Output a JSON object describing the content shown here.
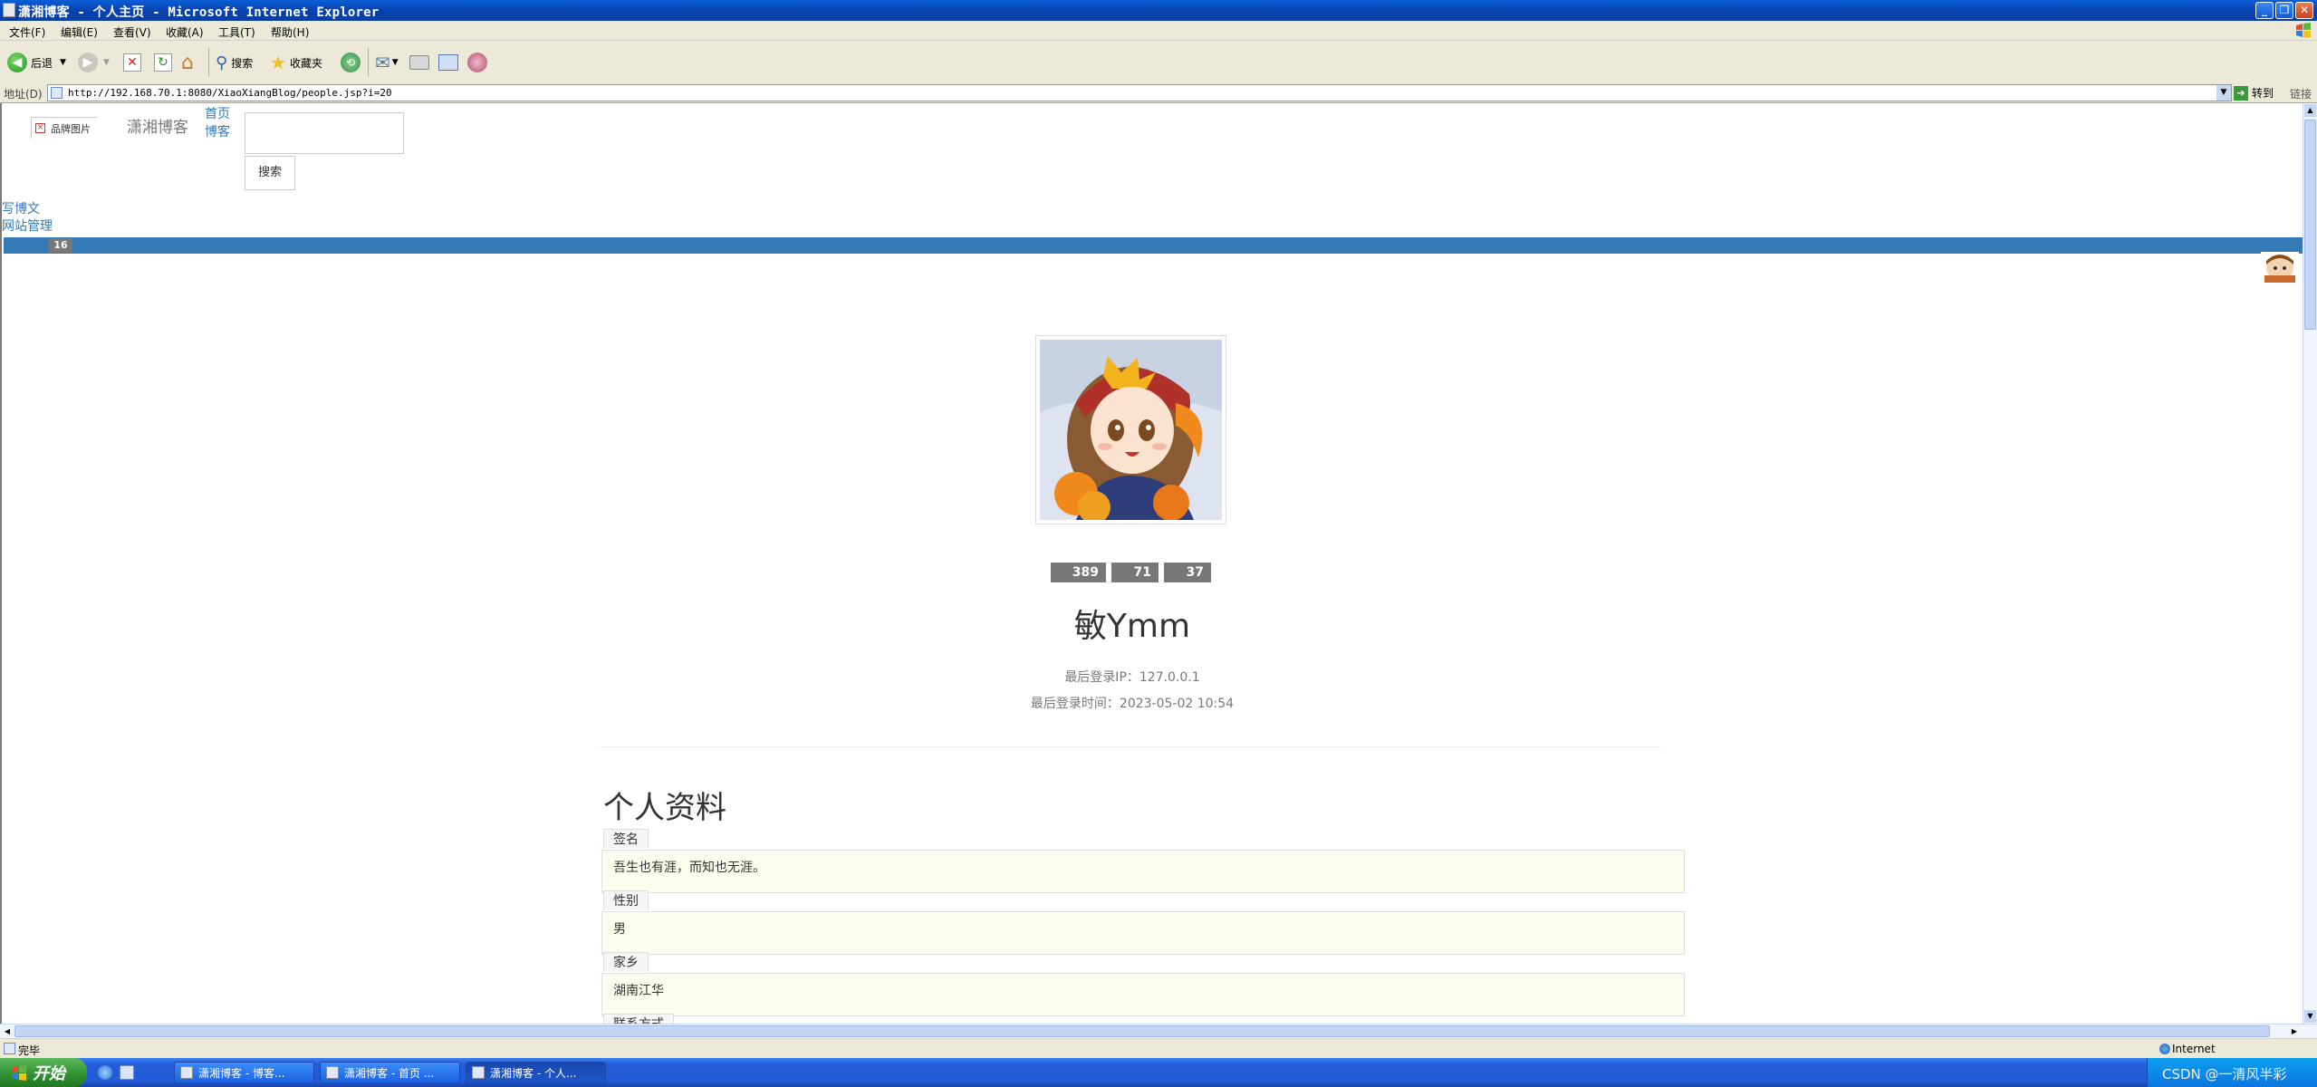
{
  "window": {
    "title": "潇湘博客 - 个人主页 - Microsoft Internet Explorer"
  },
  "menu": [
    "文件(F)",
    "编辑(E)",
    "查看(V)",
    "收藏(A)",
    "工具(T)",
    "帮助(H)"
  ],
  "toolbar": {
    "back_label": "后退",
    "search_label": "搜索",
    "favorites_label": "收藏夹"
  },
  "address": {
    "label": "地址(D)",
    "url": "http://192.168.70.1:8080/XiaoXiangBlog/people.jsp?i=20",
    "go_label": "转到",
    "links_label": "链接"
  },
  "page": {
    "brand_alt": "品牌图片",
    "brand_name": "潇湘博客",
    "nav_home": "首页",
    "nav_blog": "博客",
    "search_button": "搜索",
    "write_link": "写博文",
    "admin_link": "网站管理",
    "nav_badge": "16",
    "stats": [
      "389",
      "71",
      "37"
    ],
    "username": "敏Ymm",
    "last_ip": "最后登录IP：127.0.0.1",
    "last_time": "最后登录时间：2023-05-02 10:54",
    "section_title": "个人资料",
    "fields": [
      {
        "label": "签名",
        "value": "吾生也有涯，而知也无涯。"
      },
      {
        "label": "性别",
        "value": "男"
      },
      {
        "label": "家乡",
        "value": "湖南江华"
      },
      {
        "label": "联系方式",
        "value": ""
      }
    ]
  },
  "status": {
    "text": "完毕",
    "zone": "Internet"
  },
  "taskbar": {
    "start": "开始",
    "tasks": [
      "潇湘博客 - 博客...",
      "潇湘博客 - 首页 ...",
      "潇湘博客 - 个人..."
    ],
    "watermark": "CSDN @一清风半彩"
  },
  "colors": {
    "link": "#337ab7",
    "navbar": "#337ab7",
    "badge": "#777777",
    "field_bg": "#fdfdee"
  }
}
